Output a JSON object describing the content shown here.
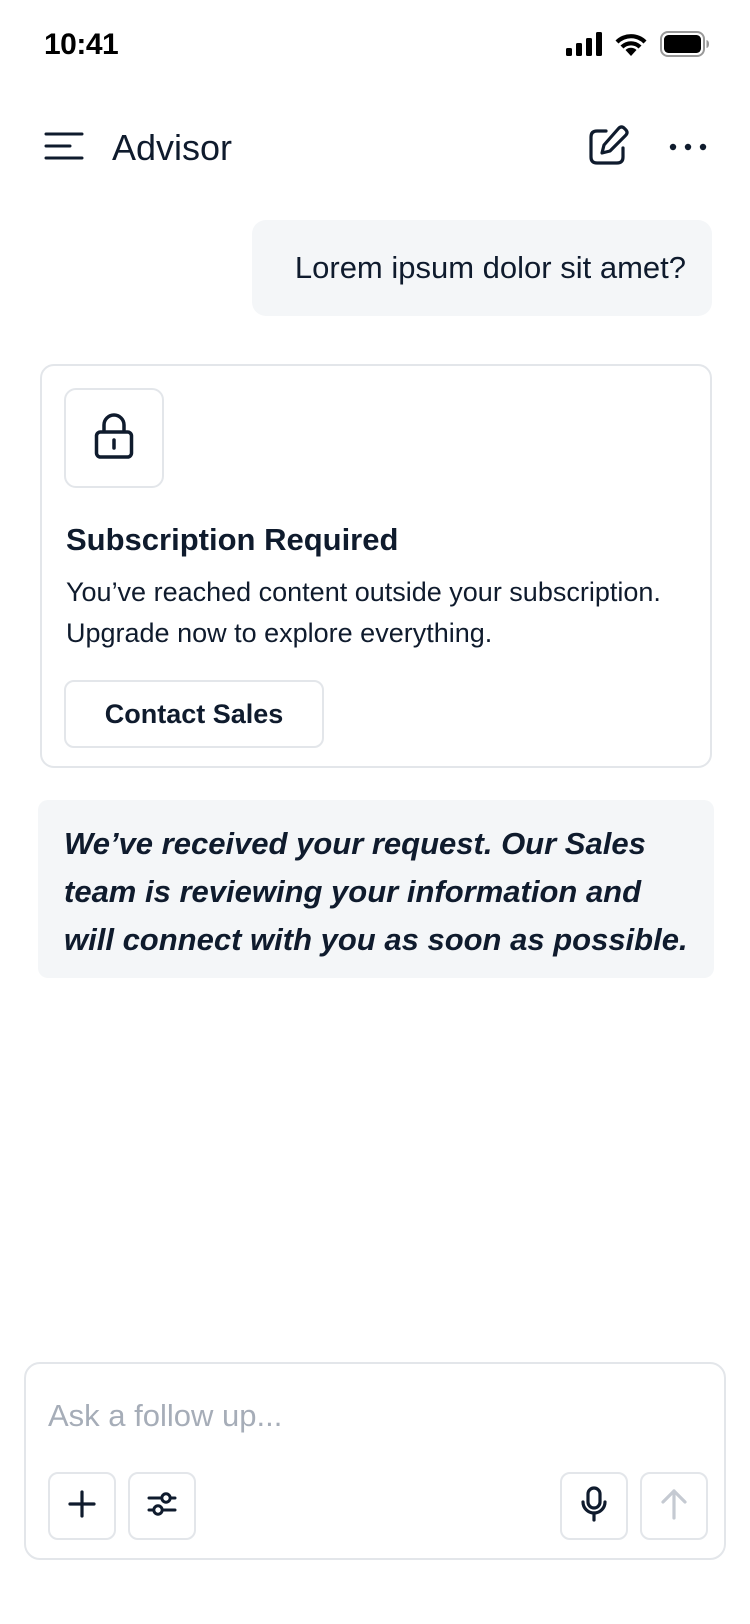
{
  "status_bar": {
    "time": "10:41"
  },
  "header": {
    "title": "Advisor"
  },
  "conversation": {
    "user_message": "Lorem ipsum dolor sit amet?",
    "subscription_card": {
      "title": "Subscription Required",
      "body": "You’ve reached content outside your subscription. Upgrade now to explore everything.",
      "button_label": "Contact Sales"
    },
    "confirmation": "We’ve received your request. Our Sales team is reviewing your information and will connect with you as soon as possible."
  },
  "composer": {
    "placeholder": "Ask a follow up..."
  },
  "colors": {
    "text": "#0f1b2d",
    "bubble_bg": "#f4f6f8",
    "border": "#e3e6ea",
    "placeholder": "#a6adb8",
    "disabled_icon": "#c5cad2"
  },
  "icons": {
    "status": [
      "cellular-signal-icon",
      "wifi-icon",
      "battery-icon"
    ],
    "header": [
      "menu-icon",
      "compose-icon",
      "more-icon"
    ],
    "card": "lock-icon",
    "composer": [
      "plus-icon",
      "filters-icon",
      "microphone-icon",
      "send-arrow-icon"
    ]
  }
}
